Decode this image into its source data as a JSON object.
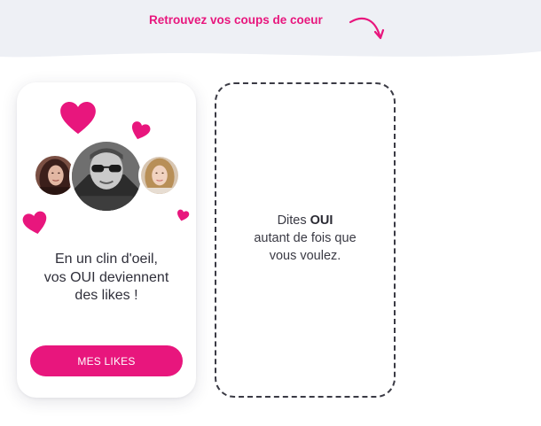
{
  "colors": {
    "accent": "#e8167d",
    "band": "#eef0f5",
    "text_dark": "#2f2f3a",
    "dashed_border": "#3a3a44"
  },
  "header": {
    "link_text": "Retrouvez vos coups de coeur",
    "arrow_icon": "curved-arrow-icon"
  },
  "likes_card": {
    "icons": [
      "heart-icon",
      "heart-icon",
      "heart-icon",
      "heart-icon"
    ],
    "avatars": [
      "avatar-woman-dark-hair",
      "avatar-man-sunglasses",
      "avatar-woman-blonde"
    ],
    "text_line1": "En un clin d'oeil,",
    "text_line2": "vos OUI deviennent",
    "text_line3": "des likes !",
    "button_label": "MES LIKES"
  },
  "placeholder_card": {
    "text_prefix": "Dites ",
    "text_bold": "OUI",
    "text_line2": "autant de fois que",
    "text_line3": "vous voulez."
  }
}
